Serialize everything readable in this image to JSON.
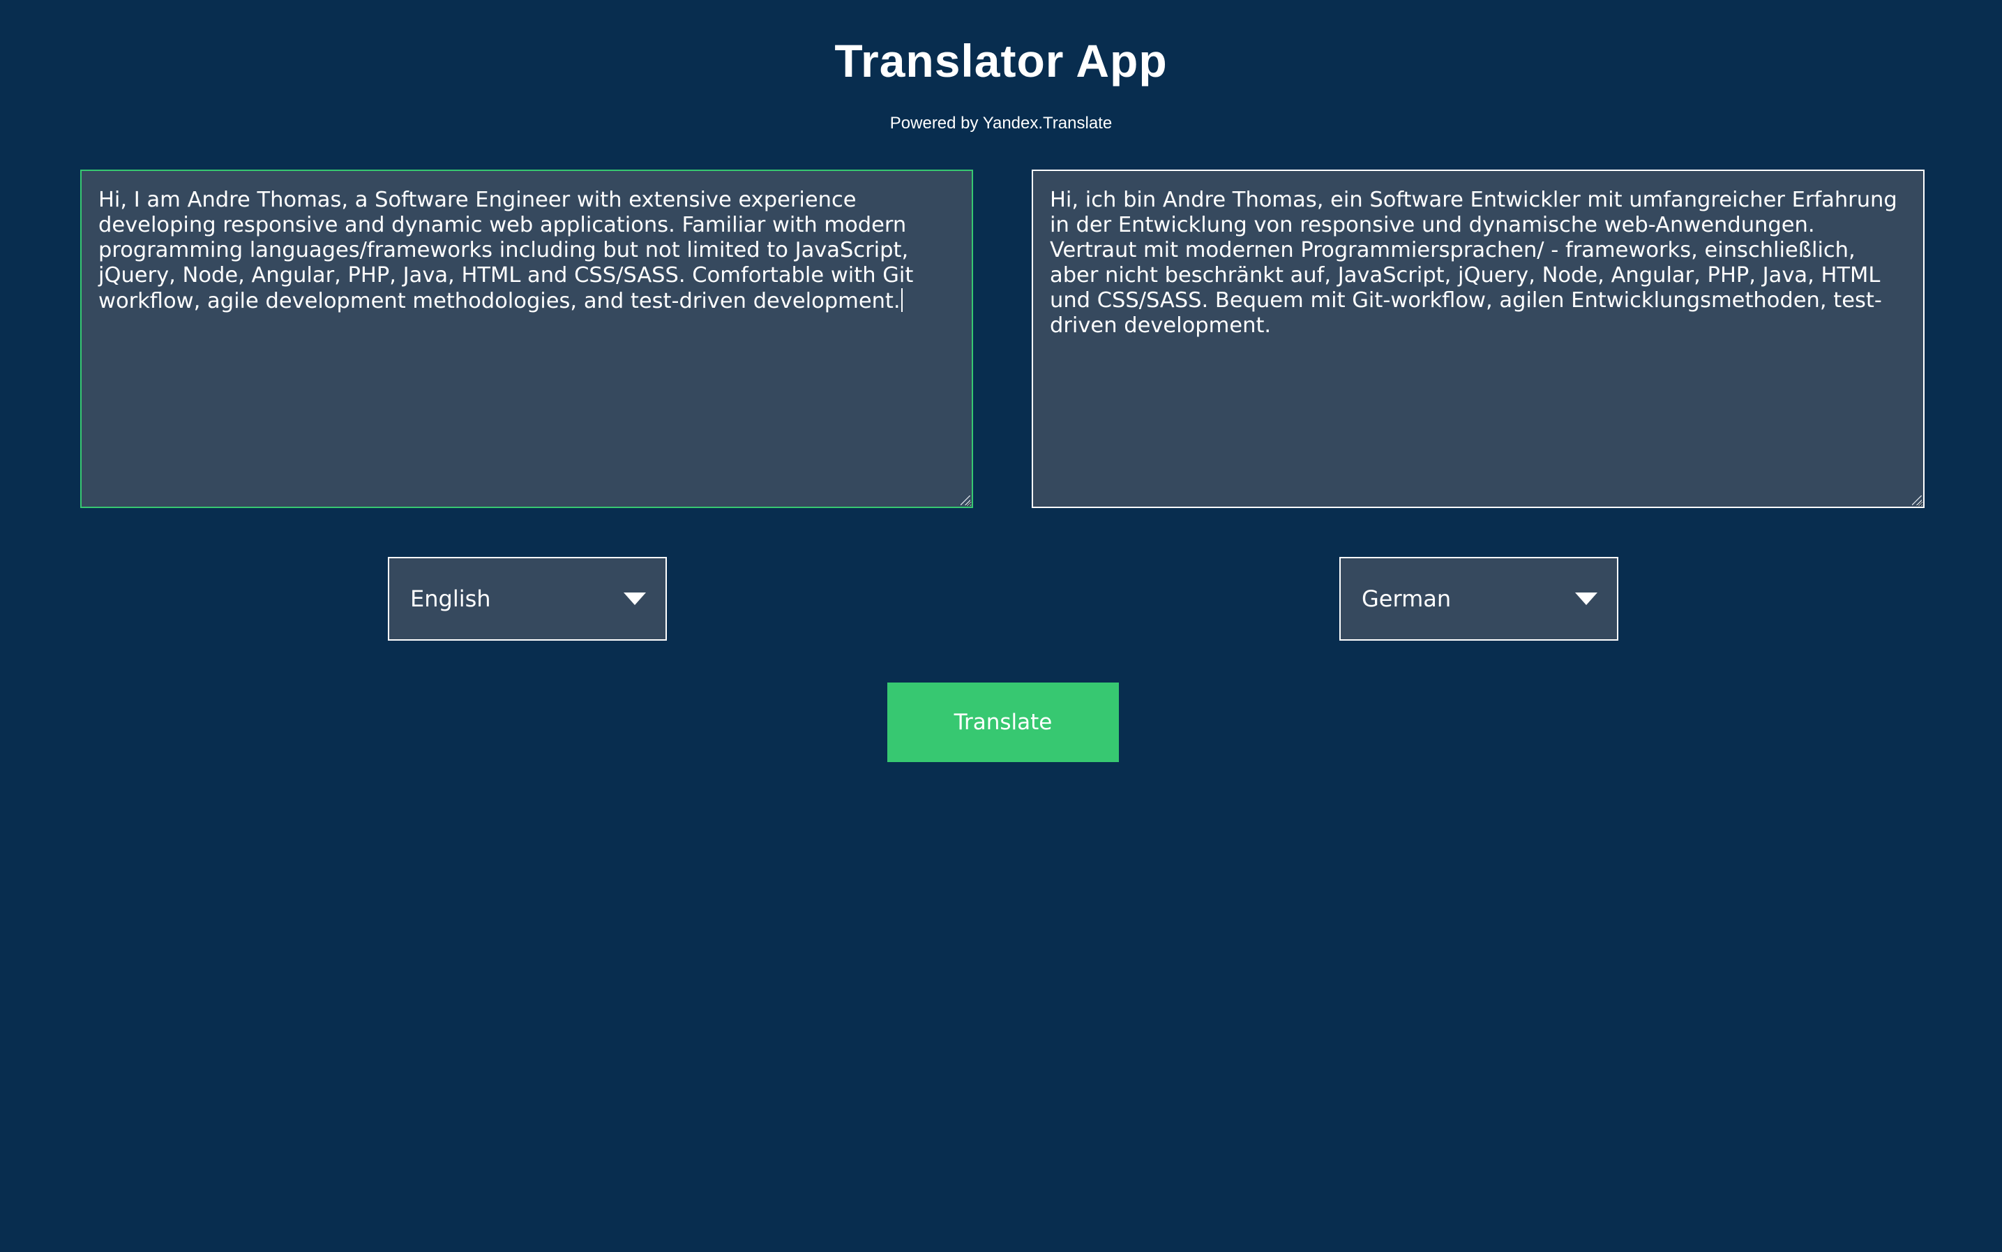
{
  "header": {
    "title": "Translator App",
    "subtitle": "Powered by Yandex.Translate"
  },
  "source": {
    "text": "Hi, I am Andre Thomas, a Software Engineer with extensive experience developing responsive and dynamic web applications. Familiar with modern programming languages/frameworks including but not limited to JavaScript, jQuery, Node, Angular, PHP, Java, HTML and CSS/SASS. Comfortable with Git workflow, agile development methodologies, and test-driven development.",
    "language": "English",
    "focused": true
  },
  "target": {
    "text": "Hi, ich bin Andre Thomas, ein Software Entwickler mit umfangreicher Erfahrung in der Entwicklung von responsive und dynamische web-Anwendungen. Vertraut mit modernen Programmiersprachen/ - frameworks, einschließlich, aber nicht beschränkt auf, JavaScript, jQuery, Node, Angular, PHP, Java, HTML und CSS/SASS. Bequem mit Git-workflow, agilen Entwicklungsmethoden, test-driven development.",
    "language": "German"
  },
  "actions": {
    "translate_label": "Translate"
  },
  "colors": {
    "background": "#082d4f",
    "panel": "#36495e",
    "accent": "#37c871",
    "text": "#ffffff"
  },
  "icons": {
    "dropdown": "caret-down-icon",
    "resize": "resize-grip-icon"
  }
}
